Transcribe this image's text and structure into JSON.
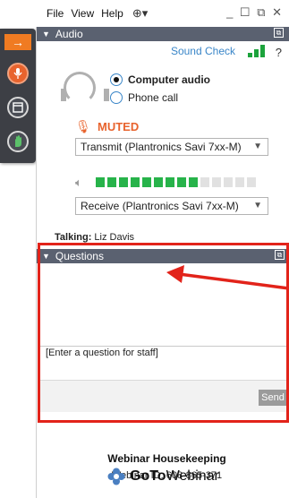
{
  "menubar": {
    "items": [
      "File",
      "View",
      "Help"
    ],
    "globe_icon": "globe-icon",
    "window_controls": "_ ☐ ⧉ ✕"
  },
  "audio": {
    "title": "Audio",
    "sound_check": "Sound Check",
    "help": "?",
    "radio_computer": "Computer audio",
    "radio_phone": "Phone call",
    "muted": "MUTED",
    "transmit": "Transmit (Plantronics Savi 7xx-M)",
    "receive": "Receive (Plantronics Savi 7xx-M)",
    "meter_level": 0.64
  },
  "talking": {
    "label": "Talking:",
    "name": "Liz Davis"
  },
  "questions": {
    "title": "Questions",
    "placeholder": "[Enter a question for staff]",
    "send": "Send"
  },
  "footer": {
    "title": "Webinar Housekeeping",
    "webinar_id": "Webinar ID: 608-865-371",
    "brand_bold": "GoTo",
    "brand_rest": "Webinar"
  },
  "colors": {
    "accent_orange": "#f07b22",
    "header_gray": "#5a6170",
    "link_blue": "#3a86c8",
    "meter_green": "#27b34a",
    "annotation_red": "#e2231a"
  }
}
